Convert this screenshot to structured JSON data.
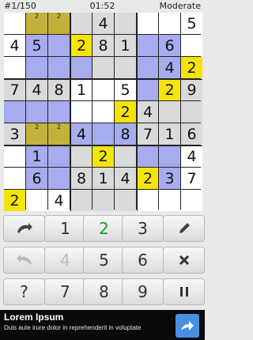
{
  "status": {
    "progress": "#1/150",
    "time": "01:52",
    "difficulty": "Moderate"
  },
  "board": {
    "cells": [
      {
        "v": "",
        "n": "",
        "s": "white"
      },
      {
        "v": "",
        "n": "2",
        "s": "olive"
      },
      {
        "v": "",
        "n": "2",
        "s": "olive"
      },
      {
        "v": "",
        "n": "",
        "s": "gray"
      },
      {
        "v": "4",
        "n": "",
        "s": "gray"
      },
      {
        "v": "",
        "n": "",
        "s": "gray"
      },
      {
        "v": "",
        "n": "",
        "s": "white"
      },
      {
        "v": "",
        "n": "",
        "s": "white"
      },
      {
        "v": "5",
        "n": "",
        "s": "white"
      },
      {
        "v": "4",
        "n": "",
        "s": "white"
      },
      {
        "v": "5",
        "n": "",
        "s": "blue"
      },
      {
        "v": "",
        "n": "",
        "s": "blue"
      },
      {
        "v": "2",
        "n": "",
        "s": "yellow"
      },
      {
        "v": "8",
        "n": "",
        "s": "gray"
      },
      {
        "v": "1",
        "n": "",
        "s": "gray"
      },
      {
        "v": "",
        "n": "",
        "s": "blue"
      },
      {
        "v": "6",
        "n": "",
        "s": "blue"
      },
      {
        "v": "",
        "n": "",
        "s": "white"
      },
      {
        "v": "",
        "n": "",
        "s": "white"
      },
      {
        "v": "",
        "n": "",
        "s": "blue"
      },
      {
        "v": "",
        "n": "",
        "s": "blue"
      },
      {
        "v": "",
        "n": "",
        "s": "blue"
      },
      {
        "v": "",
        "n": "",
        "s": "gray"
      },
      {
        "v": "",
        "n": "",
        "s": "gray"
      },
      {
        "v": "",
        "n": "",
        "s": "blue"
      },
      {
        "v": "4",
        "n": "",
        "s": "blue"
      },
      {
        "v": "2",
        "n": "",
        "s": "yellow"
      },
      {
        "v": "7",
        "n": "",
        "s": "gray"
      },
      {
        "v": "4",
        "n": "",
        "s": "gray"
      },
      {
        "v": "8",
        "n": "",
        "s": "gray"
      },
      {
        "v": "1",
        "n": "",
        "s": "white"
      },
      {
        "v": "",
        "n": "",
        "s": "white"
      },
      {
        "v": "5",
        "n": "",
        "s": "white"
      },
      {
        "v": "",
        "n": "",
        "s": "blue"
      },
      {
        "v": "2",
        "n": "",
        "s": "yellow"
      },
      {
        "v": "9",
        "n": "",
        "s": "gray"
      },
      {
        "v": "",
        "n": "",
        "s": "blue"
      },
      {
        "v": "",
        "n": "",
        "s": "blue"
      },
      {
        "v": "",
        "n": "",
        "s": "blue"
      },
      {
        "v": "",
        "n": "",
        "s": "white"
      },
      {
        "v": "",
        "n": "",
        "s": "white"
      },
      {
        "v": "2",
        "n": "",
        "s": "yellow"
      },
      {
        "v": "4",
        "n": "",
        "s": "gray"
      },
      {
        "v": "",
        "n": "",
        "s": "gray"
      },
      {
        "v": "",
        "n": "",
        "s": "gray"
      },
      {
        "v": "3",
        "n": "",
        "s": "gray"
      },
      {
        "v": "",
        "n": "2",
        "s": "olive"
      },
      {
        "v": "",
        "n": "2",
        "s": "olive"
      },
      {
        "v": "4",
        "n": "",
        "s": "blue"
      },
      {
        "v": "",
        "n": "",
        "s": "blue"
      },
      {
        "v": "8",
        "n": "",
        "s": "blue"
      },
      {
        "v": "7",
        "n": "",
        "s": "gray"
      },
      {
        "v": "1",
        "n": "",
        "s": "gray"
      },
      {
        "v": "6",
        "n": "",
        "s": "gray"
      },
      {
        "v": "",
        "n": "",
        "s": "white"
      },
      {
        "v": "1",
        "n": "",
        "s": "blue"
      },
      {
        "v": "",
        "n": "",
        "s": "blue"
      },
      {
        "v": "",
        "n": "",
        "s": "gray"
      },
      {
        "v": "2",
        "n": "",
        "s": "yellow"
      },
      {
        "v": "",
        "n": "",
        "s": "gray"
      },
      {
        "v": "",
        "n": "",
        "s": "blue"
      },
      {
        "v": "",
        "n": "",
        "s": "blue"
      },
      {
        "v": "4",
        "n": "",
        "s": "white"
      },
      {
        "v": "",
        "n": "",
        "s": "white"
      },
      {
        "v": "6",
        "n": "",
        "s": "blue"
      },
      {
        "v": "",
        "n": "",
        "s": "blue"
      },
      {
        "v": "8",
        "n": "",
        "s": "gray"
      },
      {
        "v": "1",
        "n": "",
        "s": "gray"
      },
      {
        "v": "4",
        "n": "",
        "s": "gray"
      },
      {
        "v": "2",
        "n": "",
        "s": "yellow"
      },
      {
        "v": "3",
        "n": "",
        "s": "blue"
      },
      {
        "v": "7",
        "n": "",
        "s": "white"
      },
      {
        "v": "2",
        "n": "",
        "s": "yellow"
      },
      {
        "v": "",
        "n": "",
        "s": "white"
      },
      {
        "v": "4",
        "n": "",
        "s": "white"
      },
      {
        "v": "",
        "n": "",
        "s": "gray"
      },
      {
        "v": "",
        "n": "",
        "s": "gray"
      },
      {
        "v": "",
        "n": "",
        "s": "gray"
      },
      {
        "v": "",
        "n": "",
        "s": "white"
      },
      {
        "v": "",
        "n": "",
        "s": "white"
      },
      {
        "v": "",
        "n": "",
        "s": "white"
      }
    ]
  },
  "keypad": {
    "row1": [
      "undo-icon",
      "1",
      "2",
      "3",
      "pencil-icon"
    ],
    "row2": [
      "redo-icon",
      "4",
      "5",
      "6",
      "clear-icon"
    ],
    "row3": [
      "?",
      "7",
      "8",
      "9",
      "pause-icon"
    ]
  },
  "ad": {
    "title": "Lorem Ipsum",
    "text": "Duis aute irure dolor in reprehenderit in voluptate",
    "button_icon": "share-arrow-icon"
  },
  "colors": {
    "accent": "#4a90e2",
    "selected": "#f5e40a",
    "highlight": "#a7acee",
    "green": "#1e9b2e"
  }
}
